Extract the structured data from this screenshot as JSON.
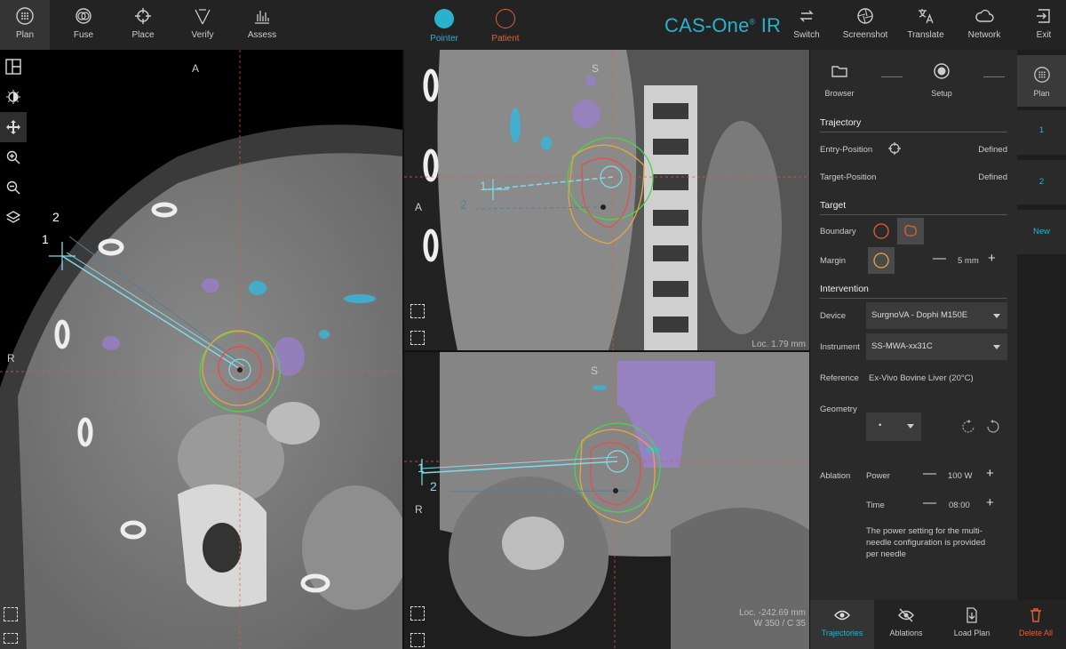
{
  "app": {
    "brand": "CAS-One",
    "brand_suffix": "IR",
    "reg": "®"
  },
  "toolbar": {
    "left_tools": [
      {
        "label": "Plan",
        "icon": "plan-icon"
      },
      {
        "label": "Fuse",
        "icon": "fuse-icon"
      },
      {
        "label": "Place",
        "icon": "place-icon"
      },
      {
        "label": "Verify",
        "icon": "verify-icon"
      },
      {
        "label": "Assess",
        "icon": "assess-icon"
      }
    ],
    "modes": [
      {
        "label": "Pointer",
        "color": "#2ab2cc"
      },
      {
        "label": "Patient",
        "color": "#e2603a"
      }
    ],
    "right_tools": [
      {
        "label": "Switch",
        "icon": "switch-icon"
      },
      {
        "label": "Screenshot",
        "icon": "screenshot-icon"
      },
      {
        "label": "Translate",
        "icon": "translate-icon"
      },
      {
        "label": "Network",
        "icon": "network-icon"
      },
      {
        "label": "Exit",
        "icon": "exit-icon"
      }
    ]
  },
  "views": {
    "axial": {
      "top": "A",
      "left": "R",
      "needle_1": "1",
      "needle_2": "2"
    },
    "coronal": {
      "top": "S",
      "left": "A",
      "needle_1": "1",
      "needle_2": "2",
      "loc": "Loc. 1.79 mm"
    },
    "sagittal": {
      "top": "S",
      "left": "R",
      "needle_1": "1",
      "needle_2": "2",
      "loc": "Loc. -242.69 mm",
      "window": "W 350 / C 35"
    }
  },
  "workflow": {
    "steps": [
      {
        "label": "Browser",
        "icon": "folder-icon"
      },
      {
        "label": "Setup",
        "icon": "record-icon"
      },
      {
        "label": "Plan",
        "icon": "plan-icon"
      }
    ]
  },
  "panel": {
    "trajectory": {
      "title": "Trajectory",
      "entry_label": "Entry-Position",
      "entry_value": "Defined",
      "target_label": "Target-Position",
      "target_value": "Defined"
    },
    "target": {
      "title": "Target",
      "boundary_label": "Boundary",
      "margin_label": "Margin",
      "margin_value": "5 mm"
    },
    "intervention": {
      "title": "Intervention",
      "device_label": "Device",
      "device_value": "SurgnoVA - Dophi M150E",
      "instrument_label": "Instrument",
      "instrument_value": "SS-MWA-xx31C",
      "reference_label": "Reference",
      "reference_value": "Ex-Vivo Bovine Liver (20°C)",
      "geometry_label": "Geometry",
      "geometry_value": "•",
      "ablation_label": "Ablation",
      "power_label": "Power",
      "power_value": "100 W",
      "time_label": "Time",
      "time_value": "08:00",
      "note": "The power setting for the multi-needle configuration is provided per needle"
    }
  },
  "needle_list": [
    "1",
    "2",
    "New"
  ],
  "bottom": [
    {
      "label": "Trajectories",
      "icon": "eye-icon",
      "color": "#2ab2cc"
    },
    {
      "label": "Ablations",
      "icon": "eye-off-icon",
      "color": "#ccc"
    },
    {
      "label": "Load Plan",
      "icon": "load-plan-icon",
      "color": "#ccc"
    },
    {
      "label": "Delete All",
      "icon": "trash-icon",
      "color": "#e2603a"
    }
  ],
  "colors": {
    "accent": "#2ab2cc",
    "patient": "#e2603a",
    "green": "#4cd34c",
    "orange": "#e5a640",
    "red": "#e0504c"
  }
}
